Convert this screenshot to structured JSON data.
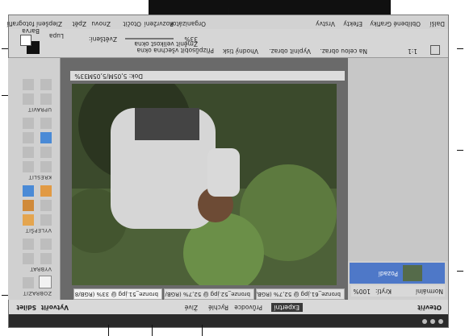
{
  "menu": {
    "items": [
      "Zlepšení fotografií",
      "Vrstva",
      "Vybrat",
      "Filtr",
      "Zobrazit",
      "Okna",
      "Nápověda"
    ],
    "secondary": [
      "Otevřít",
      "Úpravy",
      "Zpět",
      "Znovu",
      "Otočit",
      "Rozvržení",
      "Organizátor"
    ],
    "right": [
      "Vrstvy",
      "Efekty",
      "Grafiky",
      "Oblíbené",
      "Další"
    ]
  },
  "modes": {
    "left_open": "Otevřít",
    "center": [
      "Rychlé",
      "Průvodce",
      "Expertní"
    ],
    "center_extra": "Živé",
    "right": [
      "Vytvořit",
      "Sdílet"
    ]
  },
  "doc_tabs": [
    "bronze_51.jpg @ 33% (RGB/8)",
    "bronze_52.jpg @ 52,7% (RGB/8)",
    "bronze_61.jpg @ 52,7% (RGB/8)"
  ],
  "status": {
    "zoom": "33%",
    "doc": "Dok: 5,05M/5,05M"
  },
  "tool_options": {
    "tool_name": "Lupa",
    "checkbox1": "Změnit velikost okna",
    "checkbox2": "Přizpůsobit všechna okna",
    "zoom_label": "Zvětšení:",
    "zoom_value": "33%",
    "ratio": "1:1",
    "fit_buttons": [
      "Na celou obraz.",
      "Vyplnit obraz.",
      "Vhodný tisk"
    ],
    "color_label": "Barva"
  },
  "panels": {
    "zobrazit": "ZOBRAZIT",
    "vybrat": "VYBRAT",
    "vylepsit": "VYLEPŠIT",
    "kreslit": "KRESLIT",
    "upravit": "UPRAVIT",
    "barva": "BARVA"
  },
  "layers": {
    "blend": "Normální",
    "opacity_label": "Krytí:",
    "opacity_value": "100%",
    "layer_name": "Pozadí"
  },
  "colors": {
    "accent_blue": "#3f6fc4",
    "dark": "#111111",
    "panel": "#d6d6d6"
  }
}
